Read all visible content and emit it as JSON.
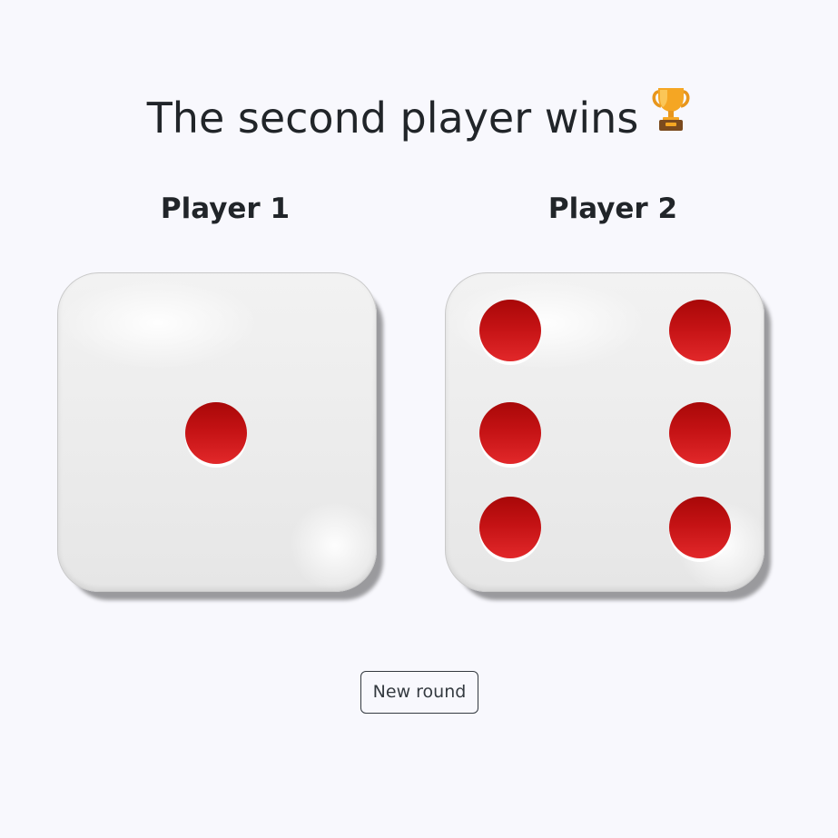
{
  "result": {
    "text": "The second player wins",
    "icon": "trophy-icon"
  },
  "players": [
    {
      "label": "Player 1",
      "die_value": 1
    },
    {
      "label": "Player 2",
      "die_value": 6
    }
  ],
  "colors": {
    "background": "#f8f8fd",
    "pip": "#c41214",
    "die_face": "#ececec",
    "text": "#212529",
    "trophy_gold": "#f5a623"
  },
  "controls": {
    "new_round_label": "New round"
  }
}
